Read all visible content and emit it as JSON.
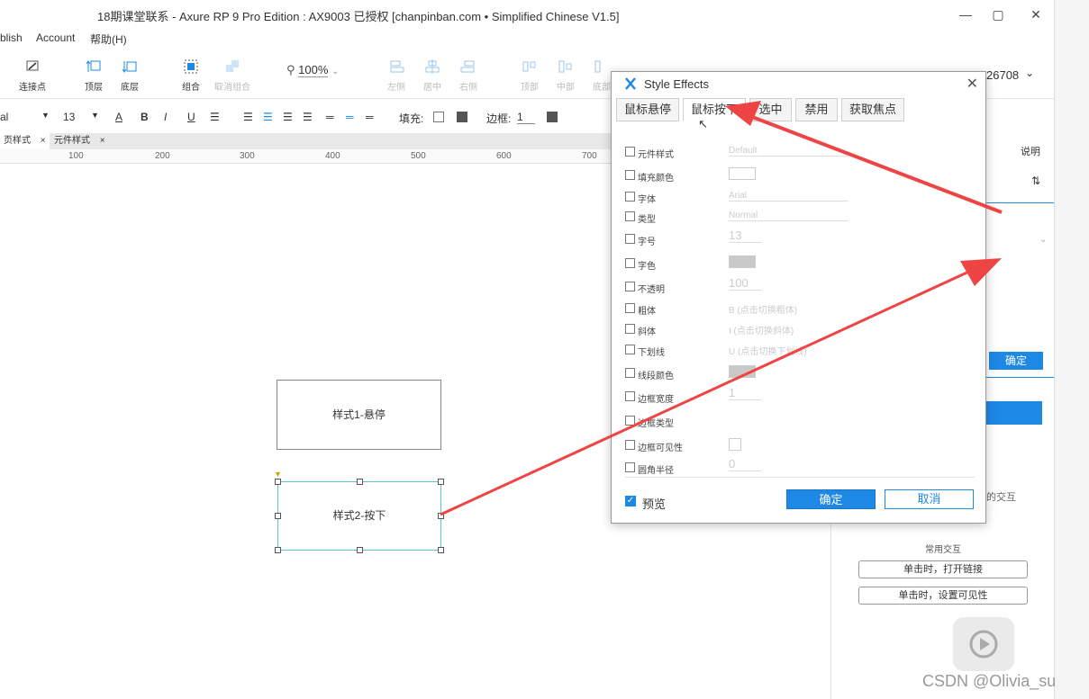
{
  "window": {
    "title": "18期课堂联系 - Axure RP 9 Pro Edition : AX9003 已授权    [chanpinban.com • Simplified Chinese V1.5]",
    "minimize": "—",
    "maximize": "▢",
    "close": "✕"
  },
  "menu": [
    "blish",
    "Account",
    "帮助(H)"
  ],
  "toolbar": {
    "tools": [
      {
        "label": "连接点",
        "disabled": false
      },
      {
        "label": "顶层",
        "disabled": false
      },
      {
        "label": "底层",
        "disabled": false
      },
      {
        "label": "组合",
        "disabled": false
      },
      {
        "label": "取消组合",
        "disabled": true
      },
      {
        "label": "左侧",
        "disabled": true
      },
      {
        "label": "居中",
        "disabled": true
      },
      {
        "label": "右侧",
        "disabled": true
      },
      {
        "label": "顶部",
        "disabled": true
      },
      {
        "label": "中部",
        "disabled": true
      },
      {
        "label": "底部",
        "disabled": true
      }
    ],
    "zoom": "100%",
    "user_id": "26708"
  },
  "format": {
    "font": "al",
    "size": "13",
    "fill_label": "填充:",
    "border_label": "边框:",
    "border_value": "1"
  },
  "tabs": [
    {
      "label": "页样式"
    },
    {
      "label": "元件样式"
    }
  ],
  "ruler": [
    "100",
    "200",
    "300",
    "400",
    "500",
    "600",
    "700"
  ],
  "canvas": {
    "shape1": "样式1-悬停",
    "shape2": "样式2-按下"
  },
  "right_panel": {
    "explain": "说明",
    "confirm": "确定",
    "interaction_suffix": "的交互",
    "common_label": "常用交互",
    "btn1": "单击时，打开链接",
    "btn2": "单击时，设置可见性"
  },
  "dialog": {
    "title": "Style Effects",
    "tabs": [
      "鼠标悬停",
      "鼠标按下",
      "选中",
      "禁用",
      "获取焦点"
    ],
    "active_tab": 1,
    "props": [
      {
        "label": "元件样式",
        "value": "Default",
        "kind": "select"
      },
      {
        "label": "填充颜色",
        "value": "",
        "kind": "swatch"
      },
      {
        "label": "字体",
        "value": "Arial",
        "kind": "select"
      },
      {
        "label": "类型",
        "value": "Normal",
        "kind": "select"
      },
      {
        "label": "字号",
        "value": "13",
        "kind": "num"
      },
      {
        "label": "字色",
        "value": "",
        "kind": "swatch-gray"
      },
      {
        "label": "不透明",
        "value": "100",
        "kind": "num"
      },
      {
        "label": "粗体",
        "value": "B (点击切换粗体)",
        "kind": "text"
      },
      {
        "label": "斜体",
        "value": "I (点击切换斜体)",
        "kind": "text"
      },
      {
        "label": "下划线",
        "value": "U (点击切换下划线)",
        "kind": "text"
      },
      {
        "label": "线段颜色",
        "value": "",
        "kind": "swatch-gray"
      },
      {
        "label": "边框宽度",
        "value": "1",
        "kind": "num"
      },
      {
        "label": "边框类型",
        "value": "",
        "kind": "text"
      },
      {
        "label": "边框可见性",
        "value": "",
        "kind": "box"
      },
      {
        "label": "圆角半径",
        "value": "0",
        "kind": "num"
      }
    ],
    "preview": "预览",
    "ok": "确定",
    "cancel": "取消"
  },
  "watermark": "CSDN @Olivia_su",
  "accent": "#1e88e5",
  "arrow_color": "#ef4444"
}
